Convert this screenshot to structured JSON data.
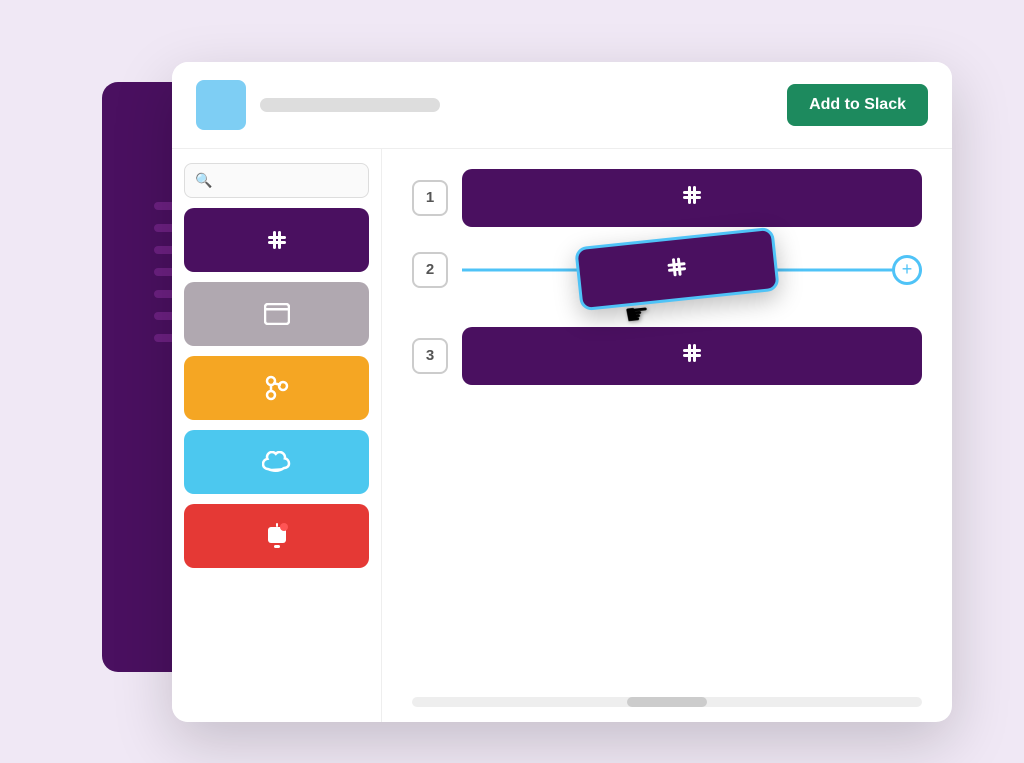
{
  "header": {
    "add_to_slack_label": "Add to Slack",
    "avatar_bg": "#7ecef4",
    "title_placeholder": ""
  },
  "sidebar": {
    "search_placeholder": "Search",
    "apps": [
      {
        "id": "slack",
        "color": "#4a1060",
        "icon": "#",
        "label": "Slack"
      },
      {
        "id": "browser",
        "color": "#b0a8b0",
        "icon": "⬜",
        "label": "Browser"
      },
      {
        "id": "source-control",
        "color": "#f5a623",
        "icon": "⑂",
        "label": "Source Control"
      },
      {
        "id": "salesforce",
        "color": "#4cc8ef",
        "icon": "☁",
        "label": "Salesforce"
      },
      {
        "id": "notifications",
        "color": "#e53935",
        "icon": "🔔",
        "label": "Notifications"
      }
    ]
  },
  "main": {
    "slots": [
      {
        "number": "1",
        "has_app": true
      },
      {
        "number": "2",
        "has_app": false,
        "is_drop_zone": true
      },
      {
        "number": "3",
        "has_app": true
      }
    ],
    "dragged_card": {
      "visible": true
    }
  },
  "colors": {
    "accent_purple": "#4a1060",
    "accent_blue": "#4fc3f7",
    "accent_green": "#1d8a5e",
    "bg_purple": "#f0e8f5",
    "sidebar_bg": "#4a1060"
  },
  "icons": {
    "search": "🔍",
    "slack_hash": "#",
    "browser": "⬛",
    "source": "⑂",
    "cloud": "☁",
    "bell": "🔔",
    "plus": "+",
    "hand_cursor": "☛"
  }
}
